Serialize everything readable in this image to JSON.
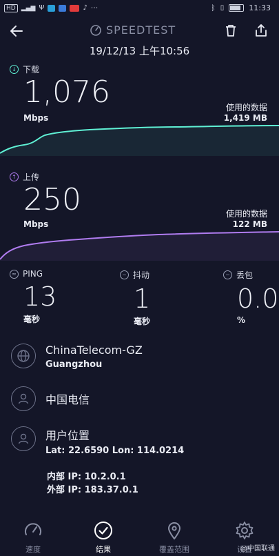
{
  "status_bar": {
    "left_icons": [
      "hd-icon",
      "signal-icon",
      "usb-icon",
      "app-icon-1",
      "app-icon-2",
      "app-icon-3",
      "tiktok-icon"
    ],
    "more": "···",
    "time": "11:33"
  },
  "header": {
    "title": "SPEEDTEST"
  },
  "datetime": "19/12/13 上午10:56",
  "download": {
    "label": "下载",
    "value": "1,076",
    "unit": "Mbps",
    "used_label": "使用的数据",
    "used_value": "1,419 MB",
    "color": "#5ff0d4"
  },
  "upload": {
    "label": "上传",
    "value": "250",
    "unit": "Mbps",
    "used_label": "使用的数据",
    "used_value": "122 MB",
    "color": "#b07cf0"
  },
  "stats": [
    {
      "label": "PING",
      "value": "13",
      "unit": "毫秒",
      "icon": "ping-icon"
    },
    {
      "label": "抖动",
      "value": "1",
      "unit": "毫秒",
      "icon": "jitter-icon"
    },
    {
      "label": "丢包",
      "value": "0.0",
      "unit": "%",
      "icon": "packet-loss-icon"
    }
  ],
  "server": {
    "name": "ChinaTelecom-GZ",
    "city": "Guangzhou"
  },
  "isp": {
    "name": "中国电信"
  },
  "location": {
    "title": "用户位置",
    "coords": "Lat: 22.6590 Lon: 114.0214",
    "internal_ip": "内部 IP: 10.2.0.1",
    "external_ip": "外部 IP: 183.37.0.1"
  },
  "nav": [
    {
      "label": "速度",
      "icon": "speedometer-icon",
      "active": false
    },
    {
      "label": "结果",
      "icon": "check-circle-icon",
      "active": true
    },
    {
      "label": "覆盖范围",
      "icon": "map-pin-icon",
      "active": false
    },
    {
      "label": "设置",
      "icon": "gear-icon",
      "active": false
    }
  ],
  "watermark": "@中国联通"
}
